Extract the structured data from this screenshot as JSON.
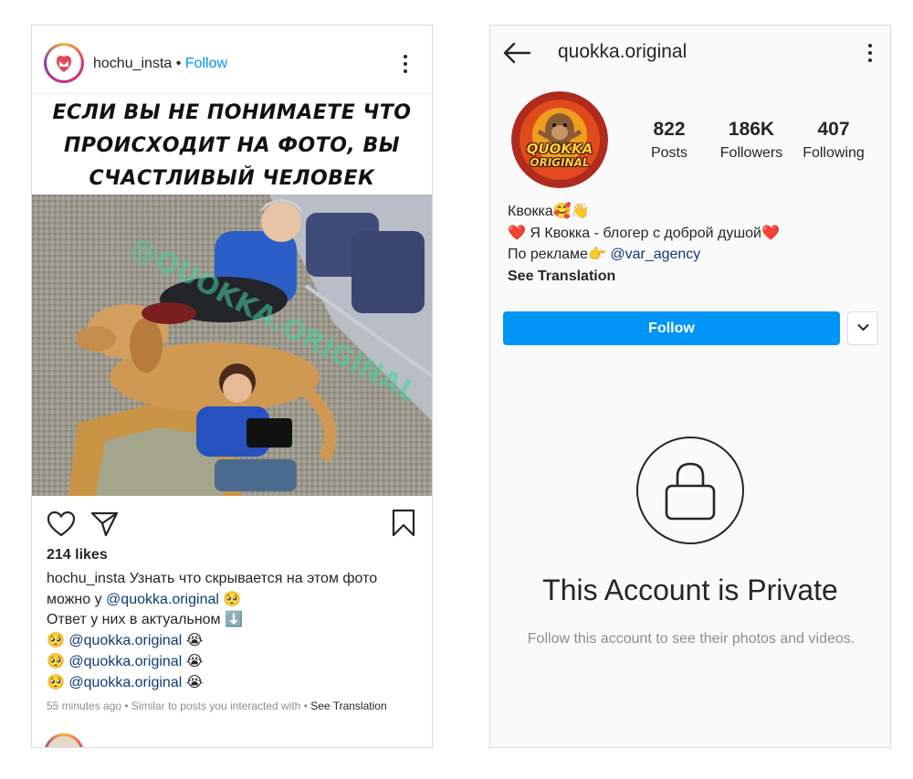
{
  "post_screen": {
    "username": "hochu_insta",
    "separator": "•",
    "follow_label": "Follow",
    "meme_text": [
      "ЕСЛИ ВЫ НЕ ПОНИМАЕТЕ ЧТО",
      "ПРОИСХОДИТ НА ФОТО, ВЫ",
      "СЧАСТЛИВЫЙ ЧЕЛОВЕК"
    ],
    "watermark": "@QUOKKA.ORIGINAL",
    "likes": "214 likes",
    "caption": {
      "username": "hochu_insta",
      "line1_text": " Узнать что скрывается на этом фото",
      "line2_prefix": "можно у ",
      "line2_mention": "@quokka.original",
      "line2_emoji": " 🥺",
      "line3": "Ответ у них в актуальном ⬇️",
      "repeat_lines": [
        {
          "pre": "🥺 ",
          "mention": "@quokka.original",
          "post": " 😭"
        },
        {
          "pre": "🥺 ",
          "mention": "@quokka.original",
          "post": " 😭"
        },
        {
          "pre": "🥺 ",
          "mention": "@quokka.original",
          "post": " 😭"
        }
      ]
    },
    "meta": {
      "time": "55 minutes ago",
      "dot1": " • ",
      "similar": "Similar to posts you interacted with",
      "dot2": " • ",
      "see_translation": "See Translation"
    },
    "icons": [
      "more-options-icon",
      "heart-icon",
      "share-icon",
      "bookmark-icon"
    ]
  },
  "profile_screen": {
    "username": "quokka.original",
    "avatar_text": [
      "QUOKKA",
      "ORIGINAL"
    ],
    "stats": [
      {
        "value": "822",
        "label": "Posts"
      },
      {
        "value": "186K",
        "label": "Followers"
      },
      {
        "value": "407",
        "label": "Following"
      }
    ],
    "bio": {
      "name": "Квокка🥰👋",
      "line2": "❤️ Я Квокка - блогер с доброй душой❤️",
      "line3_prefix": "По рекламе👉 ",
      "line3_mention": "@var_agency",
      "see_translation": "See Translation"
    },
    "follow_label": "Follow",
    "private_title": "This Account is Private",
    "private_subtitle": "Follow this account to see their photos and videos.",
    "icons": [
      "back-arrow-icon",
      "more-options-icon",
      "chevron-down-icon",
      "lock-icon"
    ],
    "colors": {
      "accent": "#0095f6",
      "mention": "#0f3b78",
      "muted": "#8e8e8e"
    }
  }
}
